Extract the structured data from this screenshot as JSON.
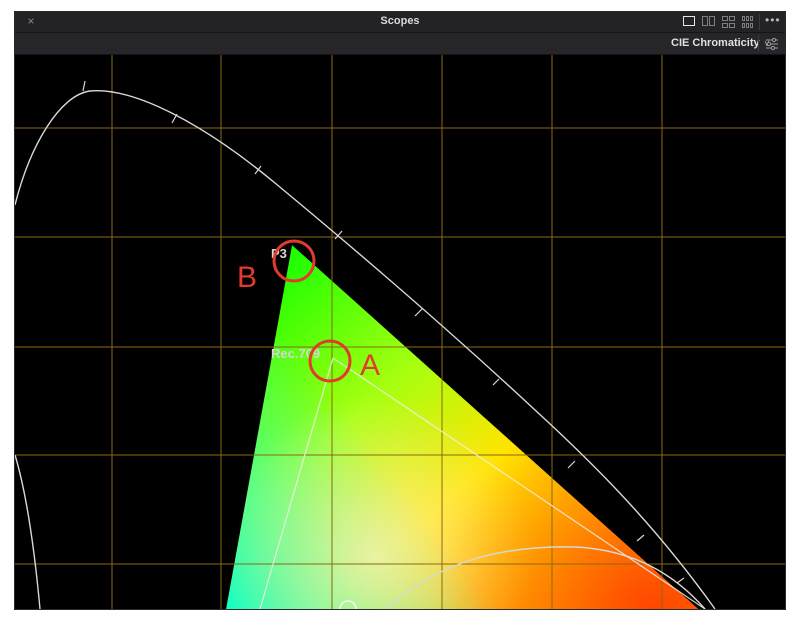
{
  "window": {
    "title": "Scopes",
    "close_glyph": "×",
    "more_glyph": "•••",
    "layout_icons": [
      "single-view-icon",
      "dual-view-icon",
      "quad-view-icon",
      "multi-view-icon"
    ]
  },
  "toolbar": {
    "mode_label": "CIE Chromaticity",
    "chevron_glyph": "∨",
    "settings_icon": "sliders-icon"
  },
  "scope": {
    "labels": {
      "p3": "P3",
      "rec709": "Rec.709"
    },
    "annotations": {
      "a": "A",
      "b": "B"
    },
    "colors": {
      "background": "#000000",
      "grid": "#8a6a10",
      "annotation": "#e23b2e",
      "locus": "#d8d8d8"
    }
  }
}
